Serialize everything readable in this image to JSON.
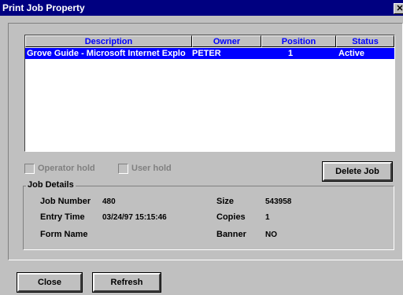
{
  "window": {
    "title": "Print Job Property",
    "close_glyph": "✕"
  },
  "table": {
    "columns": [
      "Description",
      "Owner",
      "Position",
      "Status"
    ],
    "rows": [
      {
        "description": "Grove Guide - Microsoft Internet Explo",
        "owner": "PETER",
        "position": "1",
        "status": "Active",
        "selected": true
      }
    ]
  },
  "checkboxes": {
    "operator_hold": "Operator hold",
    "user_hold": "User hold"
  },
  "buttons": {
    "delete_job": "Delete Job",
    "close": "Close",
    "refresh": "Refresh"
  },
  "job_details": {
    "legend": "Job Details",
    "job_number_label": "Job Number",
    "job_number": "480",
    "entry_time_label": "Entry Time",
    "entry_time": "03/24/97 15:15:46",
    "form_name_label": "Form Name",
    "form_name": "",
    "size_label": "Size",
    "size": "543958",
    "copies_label": "Copies",
    "copies": "1",
    "banner_label": "Banner",
    "banner": "NO"
  }
}
